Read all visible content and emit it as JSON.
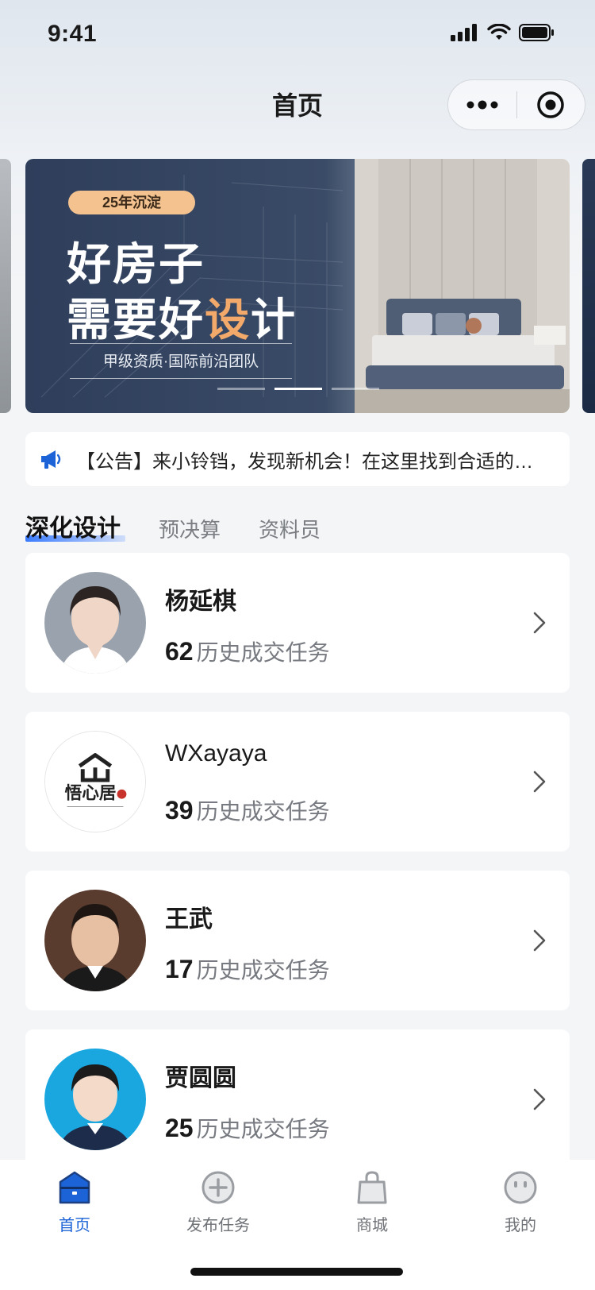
{
  "status_bar": {
    "time": "9:41"
  },
  "nav": {
    "title": "首页"
  },
  "banner": {
    "badge": "25年沉淀",
    "headline_line1": "好房子",
    "headline_line2_prefix": "需要好",
    "headline_line2_highlight": "设",
    "headline_line2_suffix": "计",
    "subline": "甲级资质·国际前沿团队",
    "slides_total": 3,
    "active_slide": 2
  },
  "notice": {
    "text": "【公告】来小铃铛，发现新机会！在这里找到合适的任务"
  },
  "tabs": [
    {
      "label": "深化设计",
      "active": true
    },
    {
      "label": "预决算",
      "active": false
    },
    {
      "label": "资料员",
      "active": false
    }
  ],
  "designers": [
    {
      "name": "杨延棋",
      "count": "62",
      "stat_label": "历史成交任务"
    },
    {
      "name": "WXayaya",
      "count": "39",
      "stat_label": "历史成交任务",
      "logo_text": "悟心居"
    },
    {
      "name": "王武",
      "count": "17",
      "stat_label": "历史成交任务"
    },
    {
      "name": "贾圆圆",
      "count": "25",
      "stat_label": "历史成交任务"
    }
  ],
  "tabbar": [
    {
      "label": "首页",
      "icon": "home-icon",
      "active": true
    },
    {
      "label": "发布任务",
      "icon": "plus-circle-icon",
      "active": false
    },
    {
      "label": "商城",
      "icon": "shopping-bag-icon",
      "active": false
    },
    {
      "label": "我的",
      "icon": "profile-face-icon",
      "active": false
    }
  ],
  "colors": {
    "accent": "#1b63d6",
    "banner_highlight": "#f2a96a",
    "badge": "#f3c28f"
  }
}
